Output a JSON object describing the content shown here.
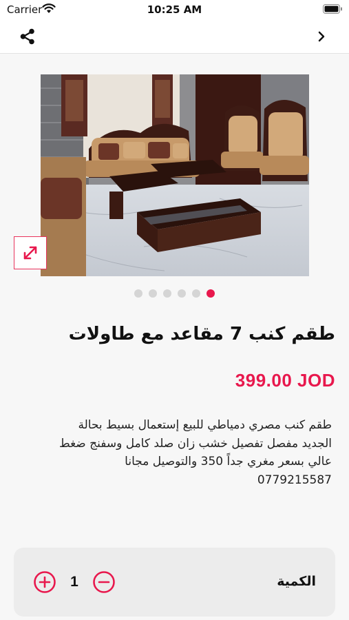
{
  "status_bar": {
    "carrier": "Carrier",
    "time": "10:25 AM"
  },
  "nav": {
    "share_icon": "share-icon",
    "forward_icon": "chevron-right-icon"
  },
  "gallery": {
    "image_count": 6,
    "active_index": 5,
    "expand_icon": "expand-icon"
  },
  "product": {
    "title": "طقم كنب 7 مقاعد مع طاولات",
    "price": "399.00 JOD",
    "description_lines": [
      "طقم كنب مصري دمياطي للبيع إستعمال بسيط بحالة",
      "الجديد مفصل تفصيل خشب زان صلد كامل وسفنج ضغط",
      "عالي بسعر مغري جداً 350 والتوصيل مجانا",
      "0779215587"
    ]
  },
  "quantity": {
    "label": "الكمية",
    "value": "1"
  },
  "colors": {
    "accent": "#e8184d",
    "background": "#f7f7f7",
    "card": "#ececec"
  }
}
